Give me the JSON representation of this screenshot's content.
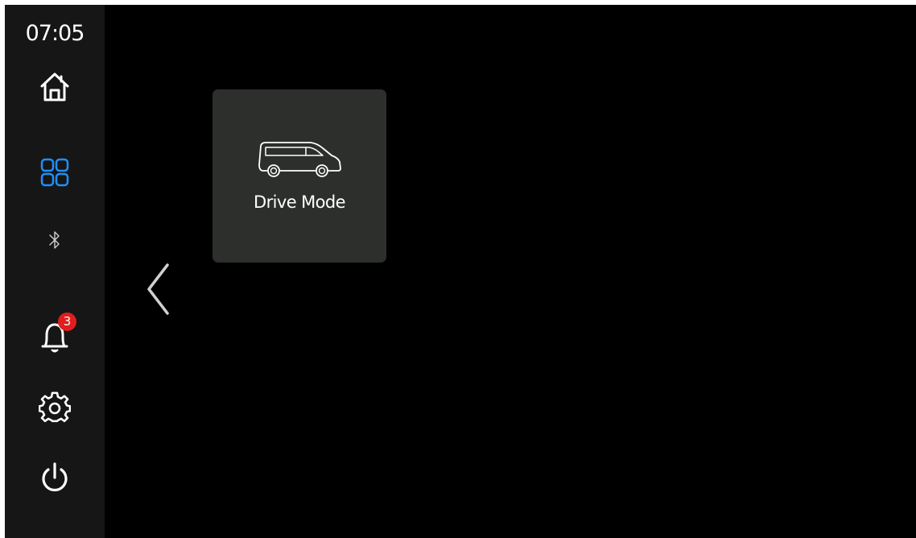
{
  "status_bar": {
    "clock": "07:05"
  },
  "sidebar": {
    "items": [
      {
        "name": "home",
        "icon": "home-icon"
      },
      {
        "name": "apps",
        "icon": "app-grid-icon",
        "active": true
      },
      {
        "name": "bluetooth",
        "icon": "bluetooth-icon"
      },
      {
        "name": "notifications",
        "icon": "bell-icon",
        "badge": "3"
      },
      {
        "name": "settings",
        "icon": "gear-icon"
      },
      {
        "name": "power",
        "icon": "power-icon"
      }
    ]
  },
  "main": {
    "back_icon": "chevron-left-icon",
    "tiles": [
      {
        "label": "Drive Mode",
        "icon": "van-icon"
      }
    ]
  },
  "colors": {
    "background": "#000000",
    "sidebar": "#161616",
    "tile": "#2c2f2c",
    "accent": "#1e90ff",
    "badge": "#e01e1e",
    "icon": "#ffffff"
  }
}
